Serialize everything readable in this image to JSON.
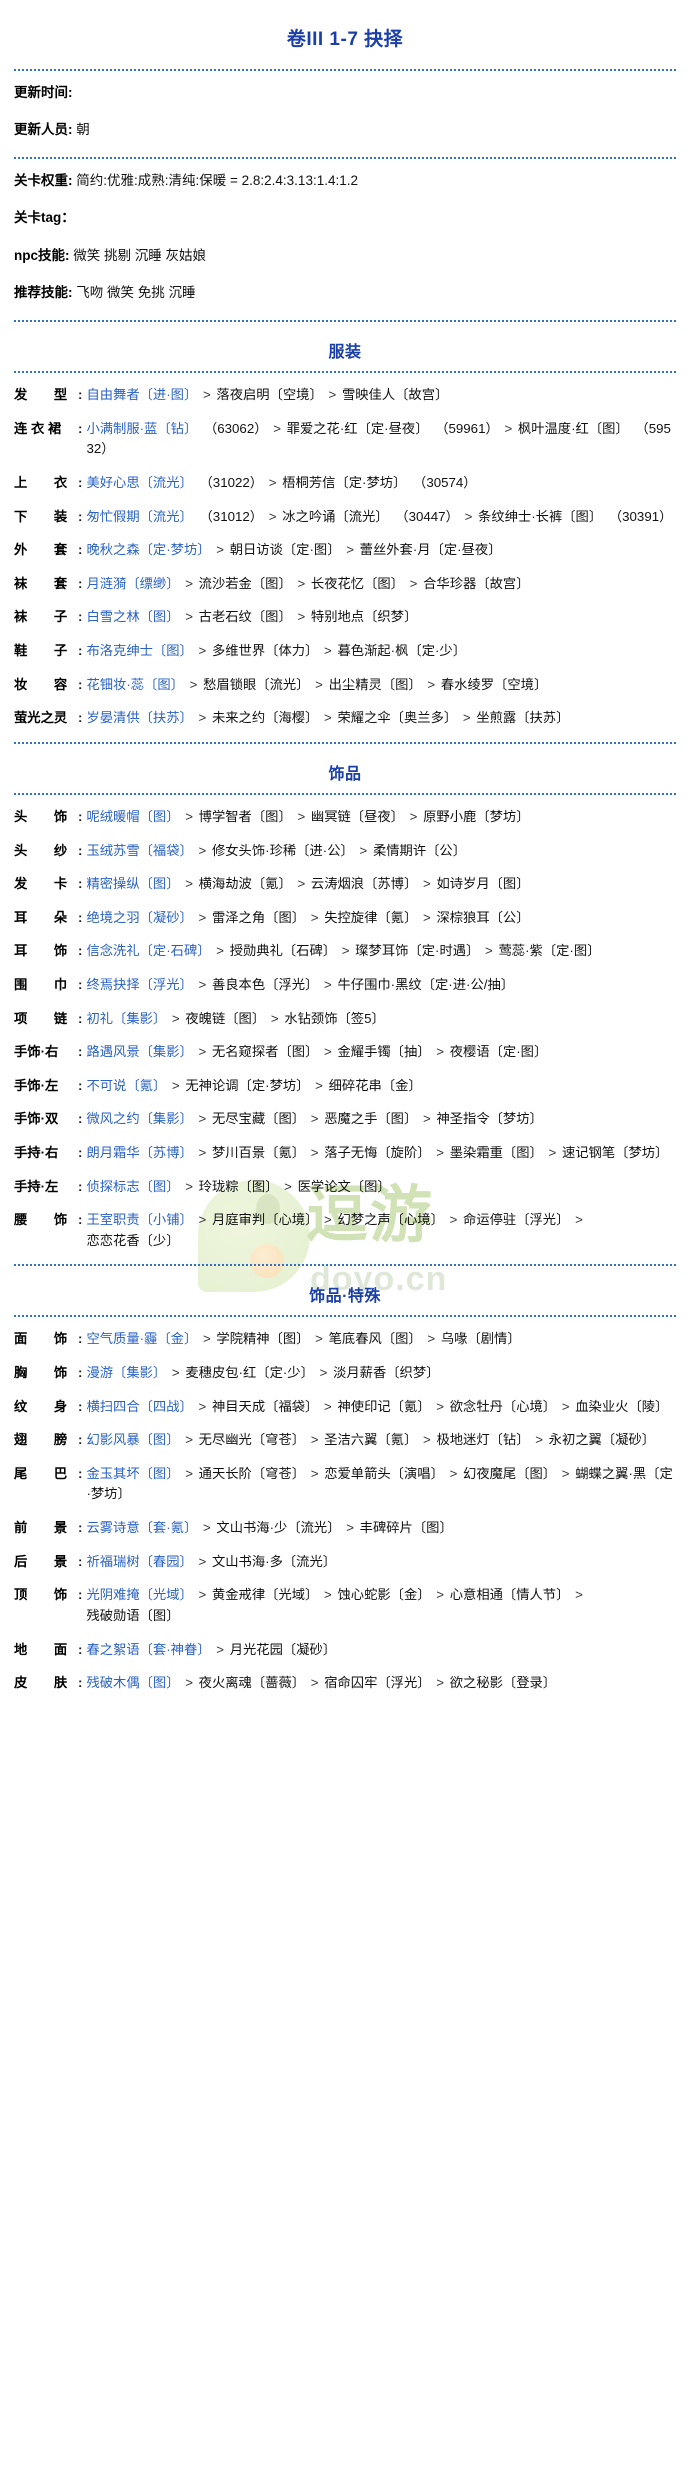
{
  "title": "卷III 1-7 抉择",
  "info": [
    {
      "key": "更新时间:",
      "value": ""
    },
    {
      "key": "更新人员:",
      "value": "朝"
    }
  ],
  "meta": [
    {
      "key": "关卡权重:",
      "value": "简约:优雅:成熟:清纯:保暖 = 2.8:2.4:3.13:1.4:1.2"
    },
    {
      "key": "关卡tag：",
      "value": ""
    },
    {
      "key": "npc技能:",
      "value": "微笑 挑剔 沉睡 灰姑娘"
    },
    {
      "key": "推荐技能:",
      "value": "飞吻 微笑 免挑 沉睡"
    }
  ],
  "watermark": {
    "brand": "逗游",
    "domain": "doyo.cn"
  },
  "sections": [
    {
      "title": "服装",
      "rows": [
        {
          "label": "发　　型",
          "items": [
            {
              "name": "自由舞者〔进·图〕",
              "code": ""
            },
            {
              "name": "落夜启明〔空境〕",
              "code": ""
            },
            {
              "name": "雪映佳人〔故宫〕",
              "code": ""
            }
          ]
        },
        {
          "label": "连 衣 裙",
          "items": [
            {
              "name": "小满制服·蓝〔钻〕",
              "code": "（63062）"
            },
            {
              "name": "罪爱之花·红〔定·昼夜〕",
              "code": "（59961）"
            },
            {
              "name": "枫叶温度·红〔图〕",
              "code": "（59532）"
            }
          ]
        },
        {
          "label": "上　　衣",
          "items": [
            {
              "name": "美好心思〔流光〕",
              "code": "（31022）"
            },
            {
              "name": "梧桐芳信〔定·梦坊〕",
              "code": "（30574）"
            }
          ]
        },
        {
          "label": "下　　装",
          "items": [
            {
              "name": "匆忙假期〔流光〕",
              "code": "（31012）"
            },
            {
              "name": "冰之吟诵〔流光〕",
              "code": "（30447）"
            },
            {
              "name": "条纹绅士·长裤〔图〕",
              "code": "（30391）"
            }
          ]
        },
        {
          "label": "外　　套",
          "items": [
            {
              "name": "晚秋之森〔定·梦坊〕",
              "code": ""
            },
            {
              "name": "朝日访谈〔定·图〕",
              "code": ""
            },
            {
              "name": "蕾丝外套·月〔定·昼夜〕",
              "code": ""
            }
          ]
        },
        {
          "label": "袜　　套",
          "items": [
            {
              "name": "月涟漪〔缥缈〕",
              "code": ""
            },
            {
              "name": "流沙若金〔图〕",
              "code": ""
            },
            {
              "name": "长夜花忆〔图〕",
              "code": ""
            },
            {
              "name": "合华珍器〔故宫〕",
              "code": ""
            }
          ]
        },
        {
          "label": "袜　　子",
          "items": [
            {
              "name": "白雪之林〔图〕",
              "code": ""
            },
            {
              "name": "古老石纹〔图〕",
              "code": ""
            },
            {
              "name": "特别地点〔织梦〕",
              "code": ""
            }
          ]
        },
        {
          "label": "鞋　　子",
          "items": [
            {
              "name": "布洛克绅士〔图〕",
              "code": ""
            },
            {
              "name": "多维世界〔体力〕",
              "code": ""
            },
            {
              "name": "暮色渐起·枫〔定·少〕",
              "code": ""
            }
          ]
        },
        {
          "label": "妆　　容",
          "items": [
            {
              "name": "花钿妆·蕊〔图〕",
              "code": ""
            },
            {
              "name": "愁眉锁眼〔流光〕",
              "code": ""
            },
            {
              "name": "出尘精灵〔图〕",
              "code": ""
            },
            {
              "name": "春水绫罗〔空境〕",
              "code": ""
            }
          ]
        },
        {
          "label": "萤光之灵",
          "items": [
            {
              "name": "岁晏清供〔扶苏〕",
              "code": ""
            },
            {
              "name": "未来之约〔海樱〕",
              "code": ""
            },
            {
              "name": "荣耀之伞〔奥兰多〕",
              "code": ""
            },
            {
              "name": "坐煎露〔扶苏〕",
              "code": ""
            }
          ]
        }
      ]
    },
    {
      "title": "饰品",
      "rows": [
        {
          "label": "头　　饰",
          "items": [
            {
              "name": "呢绒暖帽〔图〕",
              "code": ""
            },
            {
              "name": "博学智者〔图〕",
              "code": ""
            },
            {
              "name": "幽冥链〔昼夜〕",
              "code": ""
            },
            {
              "name": "原野小鹿〔梦坊〕",
              "code": ""
            }
          ]
        },
        {
          "label": "头　　纱",
          "items": [
            {
              "name": "玉绒苏雪〔福袋〕",
              "code": ""
            },
            {
              "name": "修女头饰·珍稀〔进·公〕",
              "code": ""
            },
            {
              "name": "柔情期许〔公〕",
              "code": ""
            }
          ]
        },
        {
          "label": "发　　卡",
          "items": [
            {
              "name": "精密操纵〔图〕",
              "code": ""
            },
            {
              "name": "横海劫波〔氪〕",
              "code": ""
            },
            {
              "name": "云涛烟浪〔苏博〕",
              "code": ""
            },
            {
              "name": "如诗岁月〔图〕",
              "code": ""
            }
          ]
        },
        {
          "label": "耳　　朵",
          "items": [
            {
              "name": "绝境之羽〔凝砂〕",
              "code": ""
            },
            {
              "name": "雷泽之角〔图〕",
              "code": ""
            },
            {
              "name": "失控旋律〔氪〕",
              "code": ""
            },
            {
              "name": "深棕狼耳〔公〕",
              "code": ""
            }
          ]
        },
        {
          "label": "耳　　饰",
          "items": [
            {
              "name": "信念洗礼〔定·石碑〕",
              "code": ""
            },
            {
              "name": "授勋典礼〔石碑〕",
              "code": ""
            },
            {
              "name": "璨梦耳饰〔定·时遇〕",
              "code": ""
            },
            {
              "name": "莺蕊·紫〔定·图〕",
              "code": ""
            }
          ]
        },
        {
          "label": "围　　巾",
          "items": [
            {
              "name": "终焉抉择〔浮光〕",
              "code": ""
            },
            {
              "name": "善良本色〔浮光〕",
              "code": ""
            },
            {
              "name": "牛仔围巾·黑纹〔定·进·公/抽〕",
              "code": ""
            }
          ]
        },
        {
          "label": "项　　链",
          "items": [
            {
              "name": "初礼〔集影〕",
              "code": ""
            },
            {
              "name": "夜魄链〔图〕",
              "code": ""
            },
            {
              "name": "水钻颈饰〔签5〕",
              "code": ""
            }
          ]
        },
        {
          "label": "手饰·右",
          "items": [
            {
              "name": "路遇风景〔集影〕",
              "code": ""
            },
            {
              "name": "无名窥探者〔图〕",
              "code": ""
            },
            {
              "name": "金耀手镯〔抽〕",
              "code": ""
            },
            {
              "name": "夜樱语〔定·图〕",
              "code": ""
            }
          ]
        },
        {
          "label": "手饰·左",
          "items": [
            {
              "name": "不可说〔氪〕",
              "code": ""
            },
            {
              "name": "无神论调〔定·梦坊〕",
              "code": ""
            },
            {
              "name": "细碎花串〔金〕",
              "code": ""
            }
          ]
        },
        {
          "label": "手饰·双",
          "items": [
            {
              "name": "微风之约〔集影〕",
              "code": ""
            },
            {
              "name": "无尽宝藏〔图〕",
              "code": ""
            },
            {
              "name": "恶魔之手〔图〕",
              "code": ""
            },
            {
              "name": "神圣指令〔梦坊〕",
              "code": ""
            }
          ]
        },
        {
          "label": "手持·右",
          "items": [
            {
              "name": "朗月霜华〔苏博〕",
              "code": ""
            },
            {
              "name": "梦川百景〔氪〕",
              "code": ""
            },
            {
              "name": "落子无悔〔旋阶〕",
              "code": ""
            },
            {
              "name": "墨染霜重〔图〕",
              "code": ""
            },
            {
              "name": "速记钢笔〔梦坊〕",
              "code": ""
            }
          ]
        },
        {
          "label": "手持·左",
          "items": [
            {
              "name": "侦探标志〔图〕",
              "code": ""
            },
            {
              "name": "玲珑粽〔图〕",
              "code": ""
            },
            {
              "name": "医学论文〔图〕",
              "code": ""
            }
          ]
        },
        {
          "label": "腰　　饰",
          "items": [
            {
              "name": "王室职责〔小铺〕",
              "code": ""
            },
            {
              "name": "月庭审判〔心境〕",
              "code": ""
            },
            {
              "name": "幻梦之声〔心境〕",
              "code": ""
            },
            {
              "name": "命运停驻〔浮光〕",
              "code": ""
            },
            {
              "name": "恋恋花香〔少〕",
              "code": ""
            }
          ]
        }
      ]
    },
    {
      "title": "饰品·特殊",
      "rows": [
        {
          "label": "面　　饰",
          "items": [
            {
              "name": "空气质量·霾〔金〕",
              "code": ""
            },
            {
              "name": "学院精神〔图〕",
              "code": ""
            },
            {
              "name": "笔底春风〔图〕",
              "code": ""
            },
            {
              "name": "乌喙〔剧情〕",
              "code": ""
            }
          ]
        },
        {
          "label": "胸　　饰",
          "items": [
            {
              "name": "漫游〔集影〕",
              "code": ""
            },
            {
              "name": "麦穗皮包·红〔定·少〕",
              "code": ""
            },
            {
              "name": "淡月薪香〔织梦〕",
              "code": ""
            }
          ]
        },
        {
          "label": "纹　　身",
          "items": [
            {
              "name": "横扫四合〔四战〕",
              "code": ""
            },
            {
              "name": "神目天成〔福袋〕",
              "code": ""
            },
            {
              "name": "神使印记〔氪〕",
              "code": ""
            },
            {
              "name": "欲念牡丹〔心境〕",
              "code": ""
            },
            {
              "name": "血染业火〔陵〕",
              "code": ""
            }
          ]
        },
        {
          "label": "翅　　膀",
          "items": [
            {
              "name": "幻影风暴〔图〕",
              "code": ""
            },
            {
              "name": "无尽幽光〔穹苍〕",
              "code": ""
            },
            {
              "name": "圣洁六翼〔氪〕",
              "code": ""
            },
            {
              "name": "极地迷灯〔钻〕",
              "code": ""
            },
            {
              "name": "永初之翼〔凝砂〕",
              "code": ""
            }
          ]
        },
        {
          "label": "尾　　巴",
          "items": [
            {
              "name": "金玉其坏〔图〕",
              "code": ""
            },
            {
              "name": "通天长阶〔穹苍〕",
              "code": ""
            },
            {
              "name": "恋爱单箭头〔演唱〕",
              "code": ""
            },
            {
              "name": "幻夜魔尾〔图〕",
              "code": ""
            },
            {
              "name": "蝴蝶之翼·黑〔定·梦坊〕",
              "code": ""
            }
          ]
        },
        {
          "label": "前　　景",
          "items": [
            {
              "name": "云雾诗意〔套·氪〕",
              "code": ""
            },
            {
              "name": "文山书海·少〔流光〕",
              "code": ""
            },
            {
              "name": "丰碑碎片〔图〕",
              "code": ""
            }
          ]
        },
        {
          "label": "后　　景",
          "items": [
            {
              "name": "祈福瑞树〔春园〕",
              "code": ""
            },
            {
              "name": "文山书海·多〔流光〕",
              "code": ""
            }
          ]
        },
        {
          "label": "顶　　饰",
          "items": [
            {
              "name": "光阴难掩〔光域〕",
              "code": ""
            },
            {
              "name": "黄金戒律〔光域〕",
              "code": ""
            },
            {
              "name": "蚀心蛇影〔金〕",
              "code": ""
            },
            {
              "name": "心意相通〔情人节〕",
              "code": ""
            },
            {
              "name": "残破勋语〔图〕",
              "code": ""
            }
          ]
        },
        {
          "label": "地　　面",
          "items": [
            {
              "name": "春之絮语〔套·神眷〕",
              "code": ""
            },
            {
              "name": "月光花园〔凝砂〕",
              "code": ""
            }
          ]
        },
        {
          "label": "皮　　肤",
          "items": [
            {
              "name": "残破木偶〔图〕",
              "code": ""
            },
            {
              "name": "夜火离魂〔蔷薇〕",
              "code": ""
            },
            {
              "name": "宿命囚牢〔浮光〕",
              "code": ""
            },
            {
              "name": "欲之秘影〔登录〕",
              "code": ""
            }
          ]
        }
      ]
    }
  ]
}
